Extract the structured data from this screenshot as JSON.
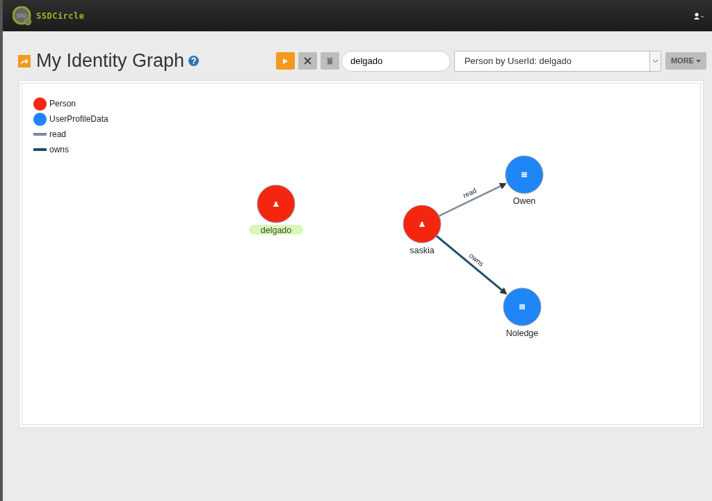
{
  "navbar": {
    "brand": "SSDCircle",
    "logo_text": "SSD"
  },
  "page": {
    "title": "My Identity Graph"
  },
  "toolbar": {
    "search_value": "delgado",
    "query": "Person by UserId: delgado",
    "more": "MORE"
  },
  "legend": [
    {
      "label": "Person",
      "kind": "node",
      "color": "#f5260f"
    },
    {
      "label": "UserProfileData",
      "kind": "node",
      "color": "#1e86f7"
    },
    {
      "label": "read",
      "kind": "edge",
      "color": "#7a8aa0"
    },
    {
      "label": "owns",
      "kind": "edge",
      "color": "#1d4e6e"
    }
  ],
  "graph": {
    "nodes": [
      {
        "label": "delgado",
        "kind": "person",
        "highlighted": true
      },
      {
        "label": "saskia",
        "kind": "person",
        "highlighted": false
      },
      {
        "label": "Owen",
        "kind": "data",
        "highlighted": false
      },
      {
        "label": "Noledge",
        "kind": "data",
        "highlighted": false
      }
    ],
    "edges": [
      {
        "label": "read",
        "kind": "read"
      },
      {
        "label": "owns",
        "kind": "owns"
      }
    ]
  }
}
